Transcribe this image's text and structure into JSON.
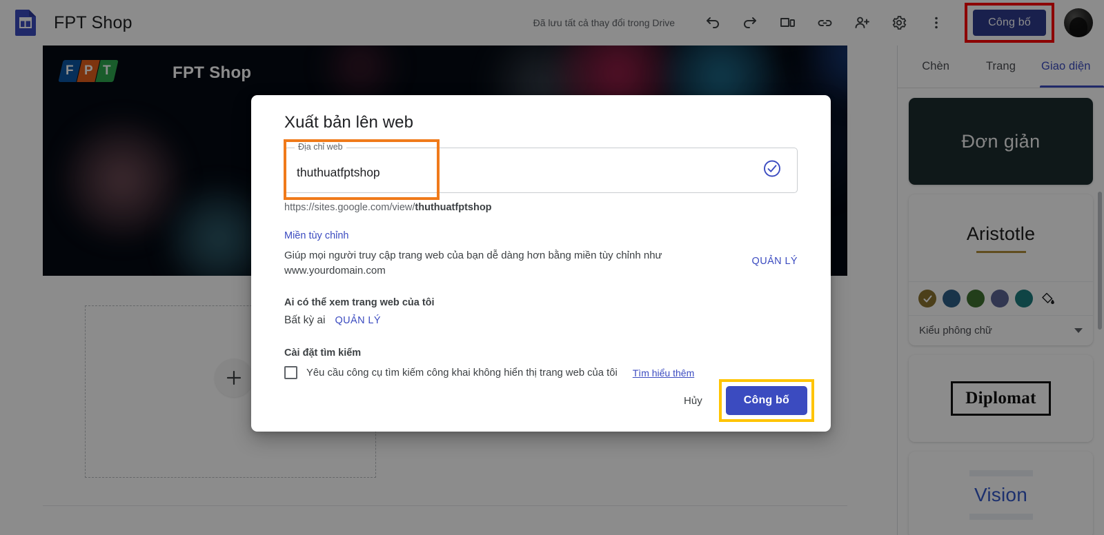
{
  "topbar": {
    "doc_icon": "google-sites-icon",
    "title": "FPT Shop",
    "save_status": "Đã lưu tất cả thay đổi trong Drive",
    "icons": [
      {
        "name": "undo-icon",
        "label": "Hoàn tác"
      },
      {
        "name": "redo-icon",
        "label": "Làm lại"
      },
      {
        "name": "preview-icon",
        "label": "Xem trước"
      },
      {
        "name": "link-icon",
        "label": "Sao chép đường liên kết"
      },
      {
        "name": "add-person-icon",
        "label": "Chia sẻ với người khác"
      },
      {
        "name": "gear-icon",
        "label": "Cài đặt"
      },
      {
        "name": "more-vert-icon",
        "label": "Tùy chọn khác"
      }
    ],
    "publish_label": "Công bố",
    "publish_highlight_color": "#FF0000",
    "publish_button_color": "#2f3b8c",
    "avatar": "user-avatar"
  },
  "canvas": {
    "banner": {
      "logo": "fpt-logo",
      "logo_letters": [
        "F",
        "P",
        "T"
      ],
      "title": "FPT Shop"
    },
    "placeholder": {
      "add_icon": "plus-icon"
    }
  },
  "sidebar": {
    "tabs": [
      {
        "label": "Chèn",
        "active": false
      },
      {
        "label": "Trang",
        "active": false
      },
      {
        "label": "Giao diện",
        "active": true
      }
    ],
    "active_tab_color": "#3b4bc0",
    "themes": [
      {
        "name": "Đơn giản",
        "selected": false
      },
      {
        "name": "Aristotle",
        "selected": true
      },
      {
        "name": "Diplomat",
        "selected": false
      },
      {
        "name": "Vision",
        "selected": false
      }
    ],
    "swatches": [
      {
        "color": "#8a7330",
        "selected": true
      },
      {
        "color": "#2f5f87",
        "selected": false
      },
      {
        "color": "#3f7230",
        "selected": false
      },
      {
        "color": "#5c6494",
        "selected": false
      },
      {
        "color": "#1c7d7f",
        "selected": false
      }
    ],
    "paint_bucket_icon": "paint-bucket-icon",
    "font_style_label": "Kiểu phông chữ"
  },
  "modal": {
    "title": "Xuất bản lên web",
    "field": {
      "legend": "Địa chỉ web",
      "value": "thuthuatfptshop",
      "placeholder": "Địa chỉ web",
      "valid_icon": "check-circle-icon",
      "highlight_color": "#F07A1A"
    },
    "url_prefix": "https://sites.google.com/view/",
    "url_slug": "thuthuatfptshop",
    "custom_domain": {
      "link_label": "Miền tùy chỉnh",
      "description": "Giúp mọi người truy cập trang web của bạn dễ dàng hơn bằng miền tùy chỉnh như www.yourdomain.com",
      "manage_label": "QUẢN LÝ"
    },
    "visibility": {
      "heading": "Ai có thể xem trang web của tôi",
      "value": "Bất kỳ ai",
      "manage_label": "QUẢN LÝ"
    },
    "search_settings": {
      "heading": "Cài đặt tìm kiếm",
      "checkbox_label": "Yêu cầu công cụ tìm kiếm công khai không hiển thị trang web của tôi",
      "checkbox_checked": false,
      "learn_more_label": "Tìm hiểu thêm"
    },
    "cancel_label": "Hủy",
    "confirm_label": "Công bố",
    "confirm_highlight_color": "#FFC400",
    "confirm_button_color": "#3b4bc0"
  }
}
